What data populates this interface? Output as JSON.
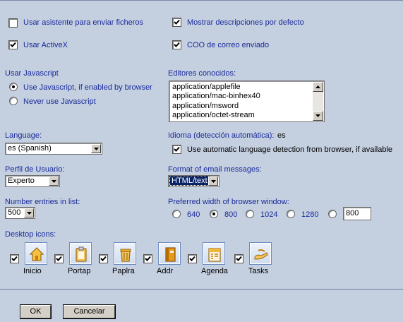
{
  "options": {
    "wizard_label": "Usar asistente para enviar ficheros",
    "wizard_checked": false,
    "activex_label": "Usar ActiveX",
    "activex_checked": true,
    "show_desc_label": "Mostrar descripciones por defecto",
    "show_desc_checked": true,
    "coo_label": "COO de correo enviado",
    "coo_checked": true
  },
  "javascript": {
    "title": "Usar Javascript",
    "options": [
      "Use Javascript, if enabled by browser",
      "Never use Javascript"
    ],
    "selected_index": 0
  },
  "editors": {
    "title": "Editores conocidos:",
    "items": [
      "application/applefile",
      "application/mac-binhex40",
      "application/msword",
      "application/octet-stream"
    ]
  },
  "language": {
    "title": "Language:",
    "value": "es (Spanish)"
  },
  "detected_language": {
    "label": "Idioma (detección automática):",
    "value": "es",
    "auto_label": "Use automatic language detection from browser, if available",
    "auto_checked": true
  },
  "profile": {
    "title": "Perfil de Usuario:",
    "value": "Experto"
  },
  "email_format": {
    "title": "Format of email messages:",
    "value": "HTML/text"
  },
  "entries": {
    "title": "Number entries in list:",
    "value": "500"
  },
  "browser_width": {
    "title": "Preferred width of browser window:",
    "options": [
      "640",
      "800",
      "1024",
      "1280"
    ],
    "selected_index": 1,
    "custom_value": "800"
  },
  "desktop_icons": {
    "title": "Desktop icons:",
    "items": [
      {
        "label": "Inicio",
        "icon": "home-icon",
        "checked": true
      },
      {
        "label": "Portap",
        "icon": "clipboard-icon",
        "checked": true
      },
      {
        "label": "Paplra",
        "icon": "trash-icon",
        "checked": true
      },
      {
        "label": "Addr",
        "icon": "address-book-icon",
        "checked": true
      },
      {
        "label": "Agenda",
        "icon": "calendar-icon",
        "checked": true
      },
      {
        "label": "Tasks",
        "icon": "tasks-icon",
        "checked": true
      }
    ]
  },
  "buttons": {
    "ok": "OK",
    "cancel": "Cancelar"
  },
  "colors": {
    "background": "#c4cfe0",
    "label_text": "#1a2a9a",
    "selection": "#0a246a"
  }
}
